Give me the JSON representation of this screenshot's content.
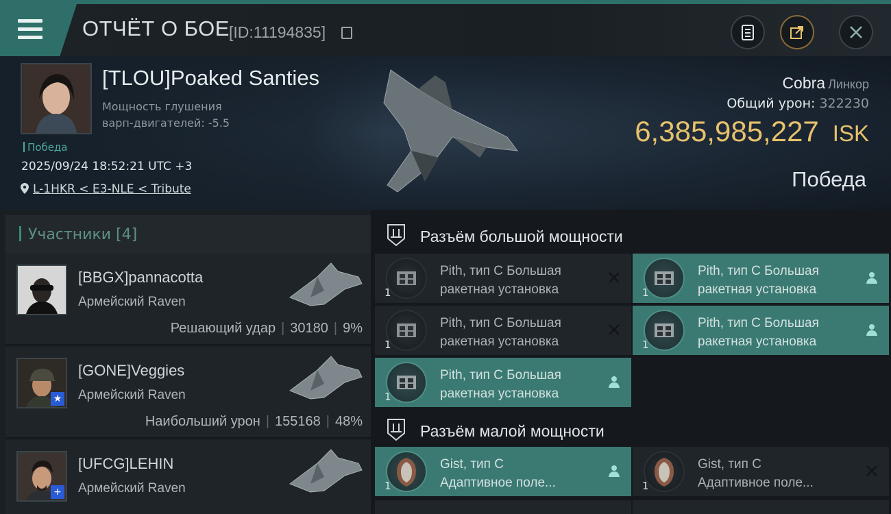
{
  "header": {
    "title": "ОТЧЁТ О БОЕ",
    "report_id": "[ID:11194835]",
    "menu_icon": "hamburger-menu-icon",
    "actions": [
      "clipboard-icon",
      "share-icon",
      "close-icon"
    ],
    "accent_color": "#2f6f69"
  },
  "victim": {
    "name": "[TLOU]Poaked Santies",
    "jam_line1": "Мощность глушения",
    "jam_line2": "варп-двигателей: -5.5",
    "tag": "Победа",
    "datetime": "2025/09/24 18:52:21 UTC +3",
    "location": "L-1HKR < E3-NLE < Tribute",
    "ship": "Cobra",
    "ship_class": "Линкор",
    "total_damage_label": "Общий урон:",
    "total_damage": "322230",
    "isk_value": "6,385,985,227",
    "isk_unit": "ISK",
    "result": "Победа",
    "isk_color": "#e7c26c"
  },
  "participants": {
    "header": "Участники [4]",
    "items": [
      {
        "name": "[BBGX]pannacotta",
        "ship": "Армейский Raven",
        "role": "Решающий удар",
        "damage": "30180",
        "percent": "9%",
        "badge": ""
      },
      {
        "name": "[GONE]Veggies",
        "ship": "Армейский Raven",
        "role": "Наибольший урон",
        "damage": "155168",
        "percent": "48%",
        "badge": "★"
      },
      {
        "name": "[UFCG]LEHIN",
        "ship": "Армейский Raven",
        "role": "",
        "damage": "",
        "percent": "",
        "badge": "+"
      }
    ]
  },
  "fittings": {
    "high_slot_title": "Разъём большой мощности",
    "low_slot_title": "Разъём малой мощности",
    "high_modules": [
      {
        "line1": "Pith, тип C Большая",
        "line2": "ракетная установка",
        "qty": "1",
        "state": "destroyed"
      },
      {
        "line1": "Pith, тип C Большая",
        "line2": "ракетная установка",
        "qty": "1",
        "state": "dropped"
      },
      {
        "line1": "Pith, тип C Большая",
        "line2": "ракетная установка",
        "qty": "1",
        "state": "destroyed"
      },
      {
        "line1": "Pith, тип C Большая",
        "line2": "ракетная установка",
        "qty": "1",
        "state": "dropped"
      },
      {
        "line1": "Pith, тип C Большая",
        "line2": "ракетная установка",
        "qty": "1",
        "state": "dropped"
      }
    ],
    "low_modules": [
      {
        "line1": "Gist, тип C",
        "line2": "Адаптивное поле...",
        "qty": "1",
        "state": "dropped"
      },
      {
        "line1": "Gist, тип C",
        "line2": "Адаптивное поле...",
        "qty": "1",
        "state": "destroyed"
      }
    ],
    "kept_color": "#3b7a73"
  }
}
